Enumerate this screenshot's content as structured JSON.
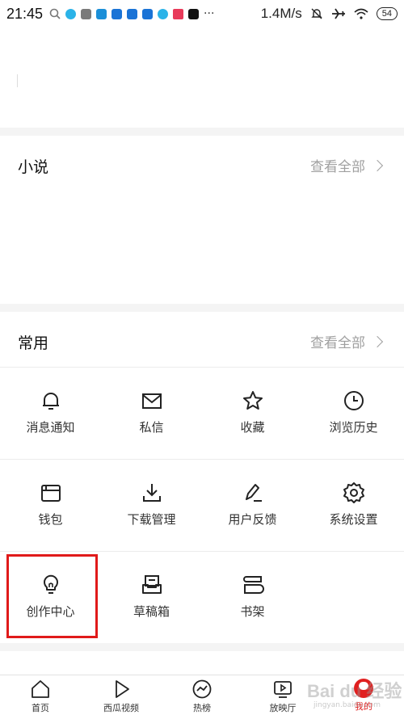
{
  "status_bar": {
    "time": "21:45",
    "net_speed": "1.4M/s",
    "battery": "54",
    "more": "···"
  },
  "novel": {
    "title": "小说",
    "see_all": "查看全部"
  },
  "common": {
    "title": "常用",
    "see_all": "查看全部",
    "items": [
      {
        "label": "消息通知",
        "icon": "bell-icon"
      },
      {
        "label": "私信",
        "icon": "mail-icon"
      },
      {
        "label": "收藏",
        "icon": "star-icon"
      },
      {
        "label": "浏览历史",
        "icon": "clock-icon"
      },
      {
        "label": "钱包",
        "icon": "wallet-icon"
      },
      {
        "label": "下载管理",
        "icon": "download-icon"
      },
      {
        "label": "用户反馈",
        "icon": "pen-icon"
      },
      {
        "label": "系统设置",
        "icon": "gear-icon"
      },
      {
        "label": "创作中心",
        "icon": "lightbulb-icon"
      },
      {
        "label": "草稿箱",
        "icon": "drafts-icon"
      },
      {
        "label": "书架",
        "icon": "bookshelf-icon"
      }
    ]
  },
  "tabbar": {
    "tabs": [
      {
        "label": "首页",
        "icon": "home-icon"
      },
      {
        "label": "西瓜视频",
        "icon": "play-icon"
      },
      {
        "label": "热榜",
        "icon": "trending-icon"
      },
      {
        "label": "放映厅",
        "icon": "tv-icon"
      },
      {
        "label": "我的",
        "icon": "avatar-icon",
        "active": true
      }
    ]
  },
  "watermark": {
    "text": "Bai du 经验",
    "sub": "jingyan.baidu.com"
  },
  "colors": {
    "accent": "#e02020",
    "highlight": "#e01a1a"
  }
}
